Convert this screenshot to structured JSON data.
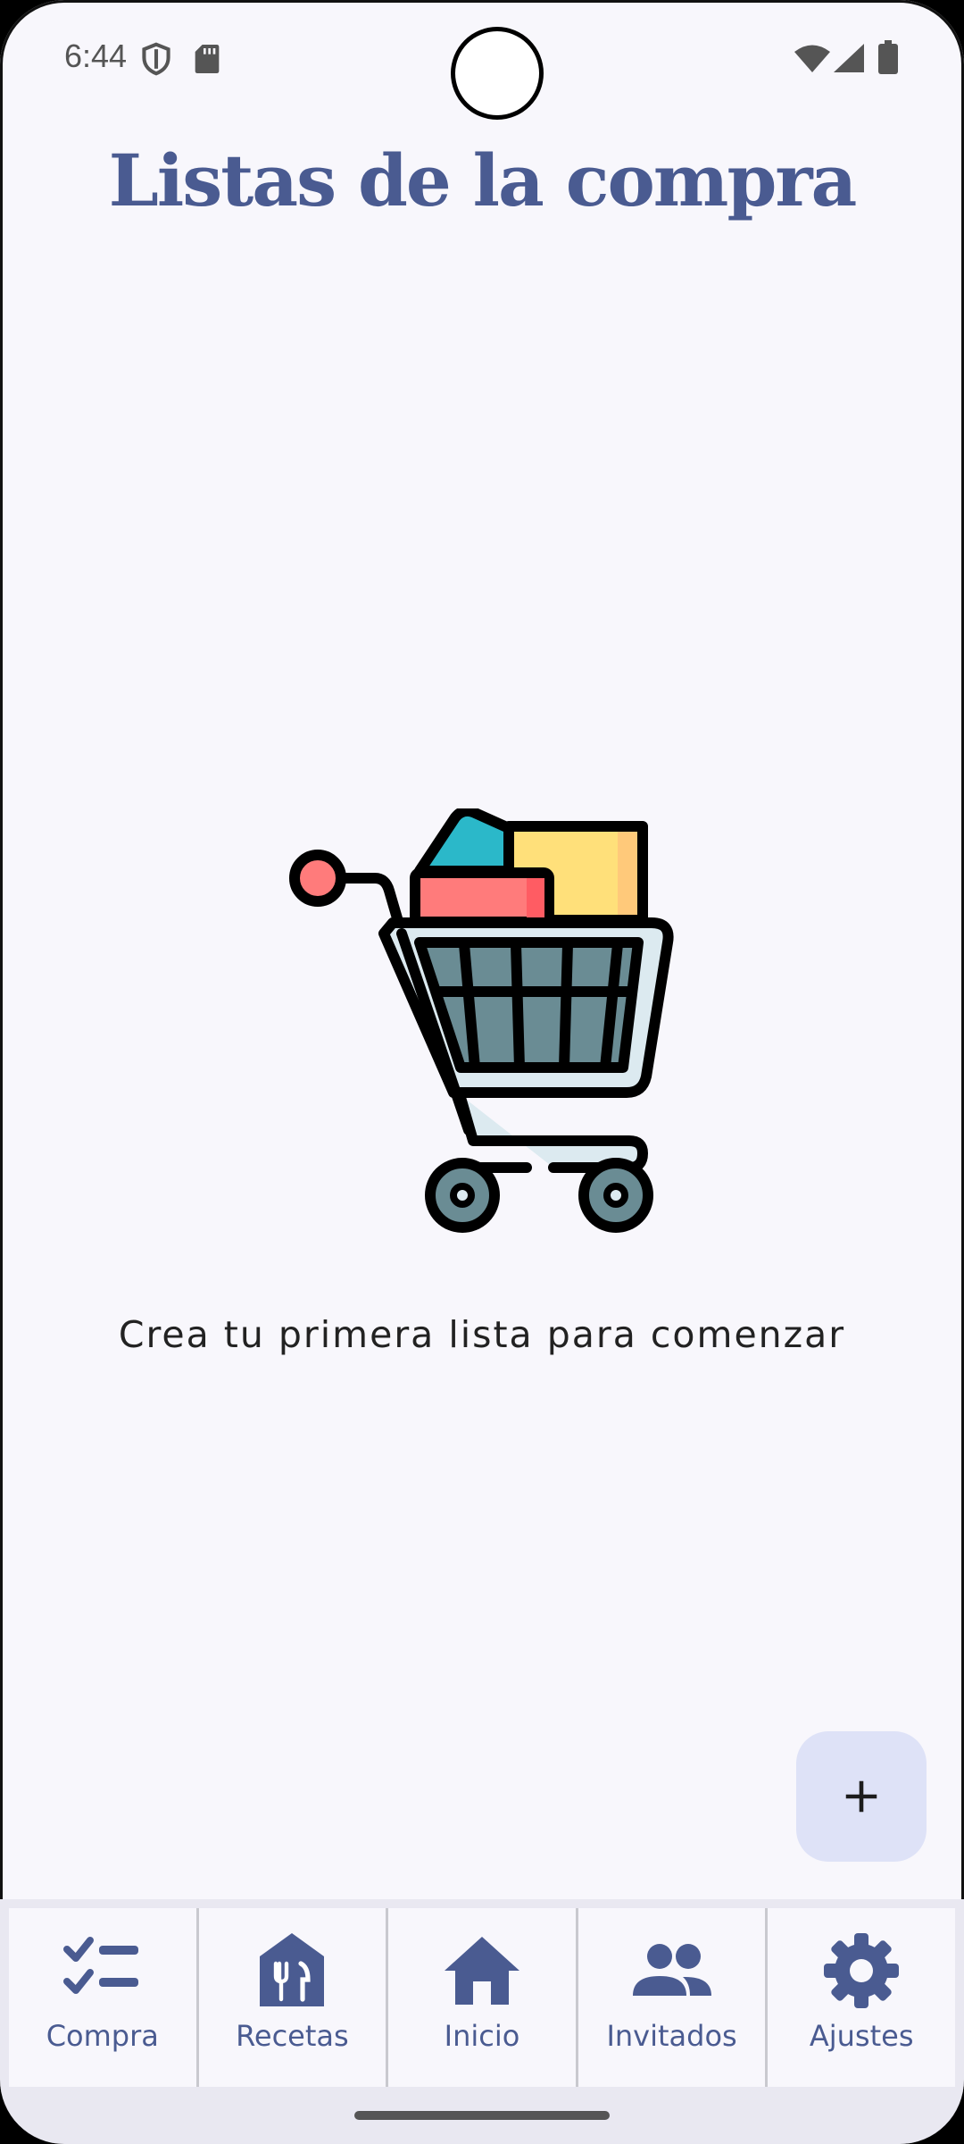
{
  "status_bar": {
    "time": "6:44",
    "icons": [
      "shield-icon",
      "sd-card-icon",
      "wifi-icon",
      "signal-icon",
      "battery-icon"
    ]
  },
  "header": {
    "title": "Listas de la compra"
  },
  "empty_state": {
    "illustration": "shopping-cart-icon",
    "message": "Crea tu primera lista para comenzar"
  },
  "fab": {
    "icon": "plus-icon"
  },
  "bottom_nav": {
    "items": [
      {
        "label": "Compra",
        "icon": "checklist-icon"
      },
      {
        "label": "Recetas",
        "icon": "restaurant-icon"
      },
      {
        "label": "Inicio",
        "icon": "home-icon"
      },
      {
        "label": "Invitados",
        "icon": "people-icon"
      },
      {
        "label": "Ajustes",
        "icon": "gear-icon"
      }
    ]
  },
  "colors": {
    "accent": "#4a5b91",
    "background": "#f8f7fc",
    "fab": "#dee2f7"
  }
}
